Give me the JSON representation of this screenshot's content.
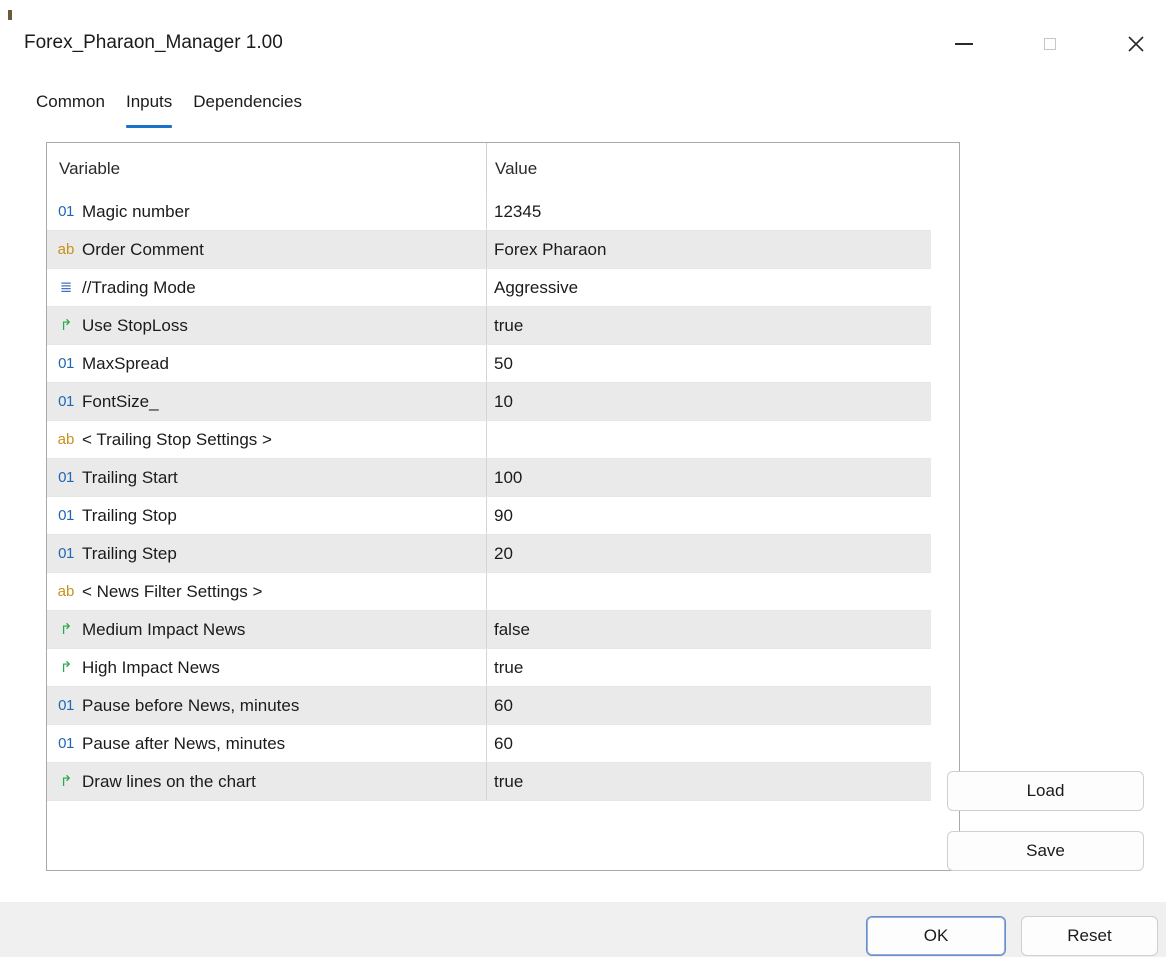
{
  "window": {
    "title": "Forex_Pharaon_Manager 1.00"
  },
  "tabs": [
    {
      "label": "Common",
      "active": false
    },
    {
      "label": "Inputs",
      "active": true
    },
    {
      "label": "Dependencies",
      "active": false
    }
  ],
  "grid": {
    "headers": {
      "variable": "Variable",
      "value": "Value"
    },
    "rows": [
      {
        "type": "int",
        "name": "Magic number",
        "value": "12345"
      },
      {
        "type": "string",
        "name": "Order Comment",
        "value": "Forex Pharaon"
      },
      {
        "type": "enum",
        "name": "//Trading Mode",
        "value": "Aggressive"
      },
      {
        "type": "bool",
        "name": "Use StopLoss",
        "value": "true"
      },
      {
        "type": "int",
        "name": "MaxSpread",
        "value": "50"
      },
      {
        "type": "int",
        "name": "FontSize_",
        "value": "10"
      },
      {
        "type": "string",
        "name": "< Trailing Stop Settings >",
        "value": ""
      },
      {
        "type": "int",
        "name": "Trailing Start",
        "value": "100"
      },
      {
        "type": "int",
        "name": "Trailing Stop",
        "value": "90"
      },
      {
        "type": "int",
        "name": "Trailing Step",
        "value": "20"
      },
      {
        "type": "string",
        "name": "< News Filter Settings >",
        "value": ""
      },
      {
        "type": "bool",
        "name": "Medium Impact News",
        "value": "false"
      },
      {
        "type": "bool",
        "name": "High Impact News",
        "value": "true"
      },
      {
        "type": "int",
        "name": "Pause before News, minutes",
        "value": "60"
      },
      {
        "type": "int",
        "name": "Pause after News, minutes",
        "value": "60"
      },
      {
        "type": "bool",
        "name": "Draw lines on the chart",
        "value": "true"
      }
    ]
  },
  "icons": {
    "int": {
      "name": "integer-type-icon",
      "glyph": "01"
    },
    "string": {
      "name": "string-type-icon",
      "glyph": "ab"
    },
    "enum": {
      "name": "enum-type-icon",
      "glyph": "≣"
    },
    "bool": {
      "name": "boolean-type-icon",
      "glyph": "↱"
    }
  },
  "buttons": {
    "load": "Load",
    "save": "Save",
    "ok": "OK",
    "reset": "Reset"
  },
  "colors": {
    "accent": "#1a73c9",
    "alt_row": "#eaeaea",
    "int_icon": "#1f67b5",
    "string_icon": "#c8901c",
    "bool_icon": "#2ba84a"
  }
}
